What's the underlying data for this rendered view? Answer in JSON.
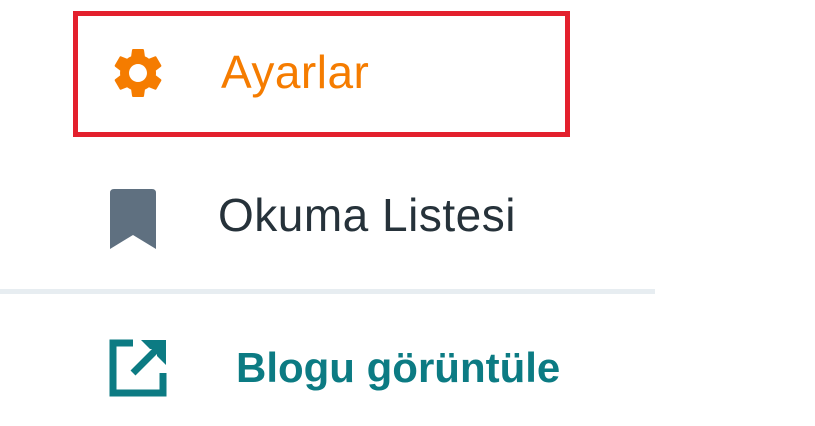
{
  "menu": {
    "settings": {
      "label": "Ayarlar",
      "icon": "gear-icon",
      "color": "#f57c00",
      "highlight_color": "#e3202d"
    },
    "reading_list": {
      "label": "Okuma Listesi",
      "icon": "bookmark-icon",
      "color": "#26323a",
      "icon_color": "#5f7080"
    },
    "view_blog": {
      "label": "Blogu görüntüle",
      "icon": "external-link-icon",
      "color": "#0c7b83"
    }
  }
}
